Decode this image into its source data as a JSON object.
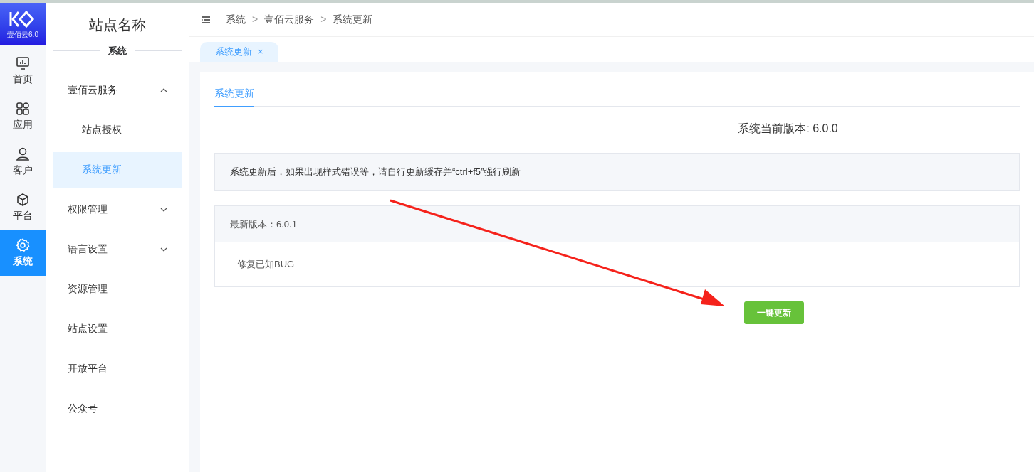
{
  "logo": {
    "caption": "壹佰云6.0"
  },
  "rail": [
    {
      "kind": "monitor",
      "label": "首页",
      "selected": false
    },
    {
      "kind": "grid",
      "label": "应用",
      "selected": false
    },
    {
      "kind": "user",
      "label": "客户",
      "selected": false
    },
    {
      "kind": "cube",
      "label": "平台",
      "selected": false
    },
    {
      "kind": "gear",
      "label": "系统",
      "selected": true
    }
  ],
  "sidebar": {
    "title": "站点名称",
    "section": "系统",
    "items": [
      {
        "label": "壹佰云服务",
        "expanded": true,
        "children": [
          {
            "label": "站点授权",
            "selected": false
          },
          {
            "label": "系统更新",
            "selected": true
          }
        ]
      },
      {
        "label": "权限管理",
        "expanded": false
      },
      {
        "label": "语言设置",
        "expanded": false
      },
      {
        "label": "资源管理"
      },
      {
        "label": "站点设置"
      },
      {
        "label": "开放平台"
      },
      {
        "label": "公众号"
      }
    ]
  },
  "breadcrumbs": [
    "系统",
    "壹佰云服务",
    "系统更新"
  ],
  "breadcrumb_separator": ">",
  "page_tabs": [
    {
      "label": "系统更新",
      "selected": true,
      "close": "×"
    }
  ],
  "content_tabs": [
    {
      "label": "系统更新",
      "selected": true
    }
  ],
  "current_version": "系统当前版本: 6.0.0",
  "notice": "系统更新后，如果出现样式错误等，请自行更新缓存并“ctrl+f5”强行刷新",
  "latest": {
    "title": "最新版本：6.0.1",
    "notes": "修复已知BUG"
  },
  "update_button": "一键更新"
}
